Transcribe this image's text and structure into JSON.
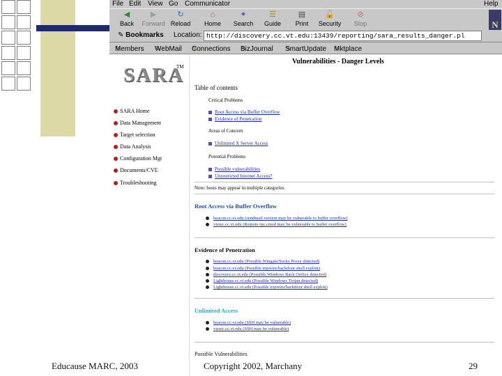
{
  "slide": {
    "footer_left": "Educause MARC, 2003",
    "footer_center": "Copyright 2002, Marchany",
    "page_number": "29"
  },
  "browser": {
    "menu": [
      "File",
      "Edit",
      "View",
      "Go",
      "Communicator"
    ],
    "help": "Help",
    "toolbar": [
      "Back",
      "Forward",
      "Reload",
      "Home",
      "Search",
      "Guide",
      "Print",
      "Security",
      "Stop"
    ],
    "bookmarks_label": "Bookmarks",
    "location_label": "Location:",
    "url": "http://discovery.cc.vt.edu:13439/reporting/sara_results_danger.pl",
    "personal_bar": [
      "Members",
      "WebMail",
      "Connections",
      "BizJournal",
      "SmartUpdate",
      "Mktplace"
    ]
  },
  "sidebar": {
    "logo": "SARA",
    "tm": "TM",
    "items": [
      "SARA Home",
      "Data Management",
      "Target selection",
      "Data Analysis",
      "Configuration Mgt",
      "Documents/CVE",
      "Troubleshooting"
    ]
  },
  "page": {
    "title": "Vulnerabilities - Danger Levels",
    "toc": "Table of contents",
    "critical": "Critical Problems",
    "critical_links": [
      "Root Access via Buffer Overflow",
      "Evidence of Penetration"
    ],
    "concern": "Areas of Concern",
    "concern_links": [
      "Unlimited X Server Access"
    ],
    "potential": "Potential Problems",
    "potential_links": [
      "Possible vulnerabilities",
      "Unrestricted Internet Access?"
    ],
    "note": "Note: hosts may appear in multiple categories.",
    "sec1_title": "Root Access via Buffer Overflow",
    "sec1_items": [
      "beacon.cc.vt.edu (sendmail version may be vulnerable to buffer overflow)",
      "visrec.cc.vt.edu (Remote rpc.cmsd may be vulnerable to buffer overflow)"
    ],
    "sec2_title": "Evidence of Penetration",
    "sec2_items": [
      "beacon.cc.vt.edu (Possible Wingate/Socks Proxy detected)",
      "beacon.cc.vt.edu (Possible tripwire/backdoor shell exploit)",
      "discovery.cc.vt.edu (Possible Windows Back Orifice detected)",
      "Lighthouse.cc.vt.edu (Possible Windows Trojan detected)",
      "Lighthouse.cc.vt.edu (Possible tripwire/backdoor shell exploit)"
    ],
    "sec3_title": "Unlimited Access",
    "sec3_items": [
      "beacon.cc.vt.edu (SSH may be vulnerable)",
      "visrec.cc.vt.edu (SSH may be vulnerable)"
    ],
    "sec4_title": "Possible Vulnerabilities"
  },
  "colors": {
    "deco_tan": "#dcd9a6",
    "deco_navy": "#1d2b6b",
    "link_blue": "#1b2aa8",
    "nav_dot_red": "#b22020"
  },
  "icons": [
    "back-arrow-icon",
    "forward-arrow-icon",
    "reload-icon",
    "home-icon",
    "search-icon",
    "guide-icon",
    "print-icon",
    "security-lock-icon",
    "stop-icon",
    "netscape-logo-icon"
  ]
}
